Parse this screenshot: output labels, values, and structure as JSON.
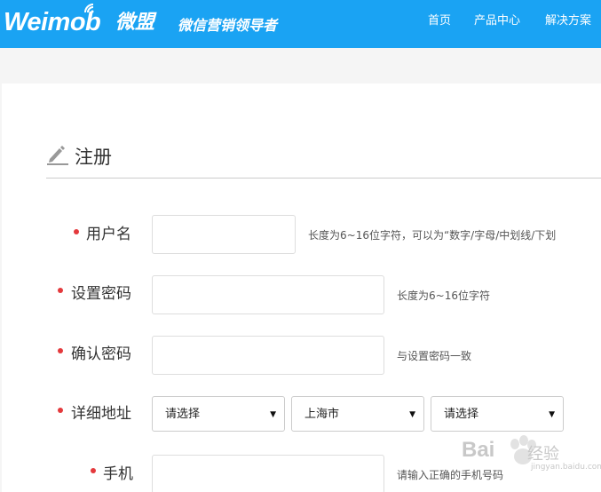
{
  "header": {
    "logo_text": "Weimob",
    "logo_cn": "微盟",
    "slogan": "微信营销领导者",
    "nav": [
      {
        "label": "首页"
      },
      {
        "label": "产品中心"
      },
      {
        "label": "解决方案"
      }
    ]
  },
  "form": {
    "title": "注册",
    "fields": {
      "username": {
        "label": "用户名",
        "value": "",
        "hint": "长度为6~16位字符，可以为“数字/字母/中划线/下划"
      },
      "password": {
        "label": "设置密码",
        "value": "",
        "hint": "长度为6~16位字符"
      },
      "confirm": {
        "label": "确认密码",
        "value": "",
        "hint": "与设置密码一致"
      },
      "address": {
        "label": "详细地址",
        "selects": [
          {
            "selected": "请选择"
          },
          {
            "selected": "上海市"
          },
          {
            "selected": "请选择"
          }
        ]
      },
      "phone": {
        "label": "手机",
        "value": "",
        "hint": "请输入正确的手机号码"
      }
    }
  },
  "watermark": {
    "text": "Bai",
    "text_cn": "经验",
    "sub": "jingyan.baidu.com"
  },
  "colors": {
    "header_bg": "#1aa3f3",
    "required_dot": "#e4393c"
  }
}
